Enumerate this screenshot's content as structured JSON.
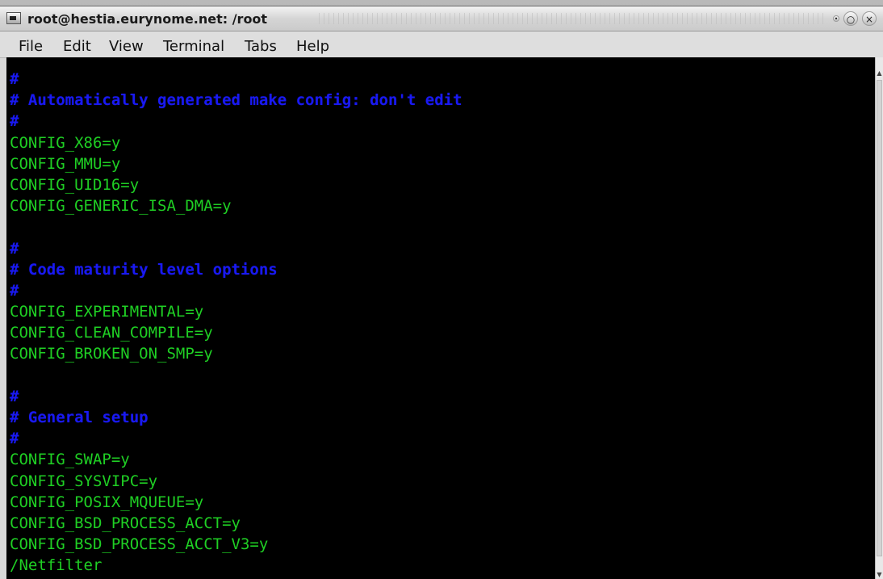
{
  "window": {
    "title": "root@hestia.eurynome.net: /root"
  },
  "menu": {
    "items": [
      {
        "label": "File"
      },
      {
        "label": "Edit"
      },
      {
        "label": "View"
      },
      {
        "label": "Terminal"
      },
      {
        "label": "Tabs"
      },
      {
        "label": "Help"
      }
    ]
  },
  "terminal": {
    "lines": [
      {
        "type": "comment",
        "text": "#"
      },
      {
        "type": "comment",
        "text": "# Automatically generated make config: don't edit"
      },
      {
        "type": "comment",
        "text": "#"
      },
      {
        "type": "config",
        "text": "CONFIG_X86=y"
      },
      {
        "type": "config",
        "text": "CONFIG_MMU=y"
      },
      {
        "type": "config",
        "text": "CONFIG_UID16=y"
      },
      {
        "type": "config",
        "text": "CONFIG_GENERIC_ISA_DMA=y"
      },
      {
        "type": "blank",
        "text": ""
      },
      {
        "type": "comment",
        "text": "#"
      },
      {
        "type": "comment",
        "text": "# Code maturity level options"
      },
      {
        "type": "comment",
        "text": "#"
      },
      {
        "type": "config",
        "text": "CONFIG_EXPERIMENTAL=y"
      },
      {
        "type": "config",
        "text": "CONFIG_CLEAN_COMPILE=y"
      },
      {
        "type": "config",
        "text": "CONFIG_BROKEN_ON_SMP=y"
      },
      {
        "type": "blank",
        "text": ""
      },
      {
        "type": "comment",
        "text": "#"
      },
      {
        "type": "comment",
        "text": "# General setup"
      },
      {
        "type": "comment",
        "text": "#"
      },
      {
        "type": "config",
        "text": "CONFIG_SWAP=y"
      },
      {
        "type": "config",
        "text": "CONFIG_SYSVIPC=y"
      },
      {
        "type": "config",
        "text": "CONFIG_POSIX_MQUEUE=y"
      },
      {
        "type": "config",
        "text": "CONFIG_BSD_PROCESS_ACCT=y"
      },
      {
        "type": "config",
        "text": "CONFIG_BSD_PROCESS_ACCT_V3=y"
      },
      {
        "type": "plain",
        "text": "/Netfilter"
      }
    ]
  }
}
